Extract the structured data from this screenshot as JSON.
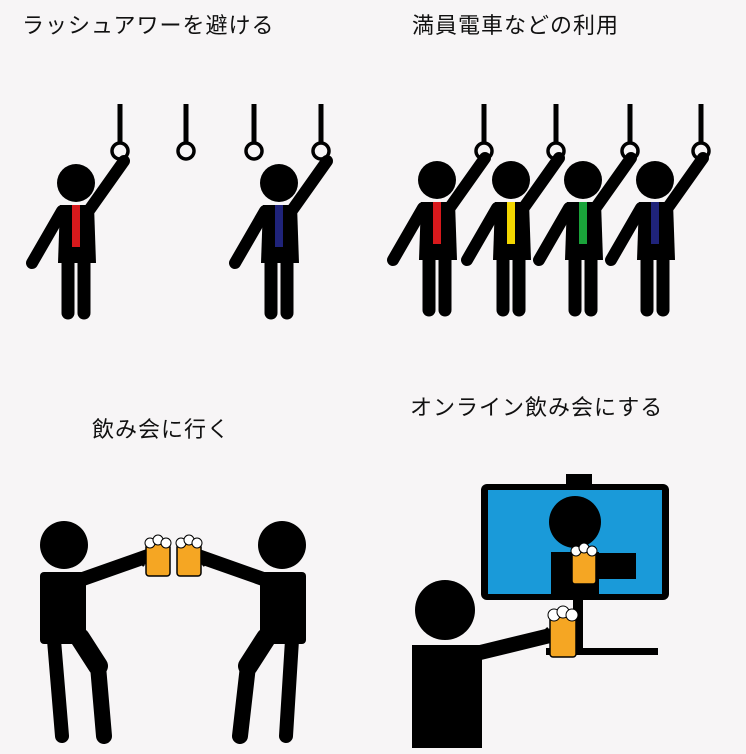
{
  "panels": {
    "rush_hour": {
      "caption": "ラッシュアワーを避ける"
    },
    "crowded_train": {
      "caption": "満員電車などの利用"
    },
    "drinking_party": {
      "caption": "飲み会に行く"
    },
    "online_drinking": {
      "caption": "オンライン飲み会にする"
    }
  },
  "colors": {
    "figure": "#000000",
    "background": "#f7f5f6",
    "tie_red": "#d7191c",
    "tie_navy": "#1f237a",
    "tie_yellow": "#f2d600",
    "tie_green": "#1aa33a",
    "beer": "#f5a623",
    "foam": "#ffffff",
    "monitor_screen": "#1a9ad9"
  }
}
